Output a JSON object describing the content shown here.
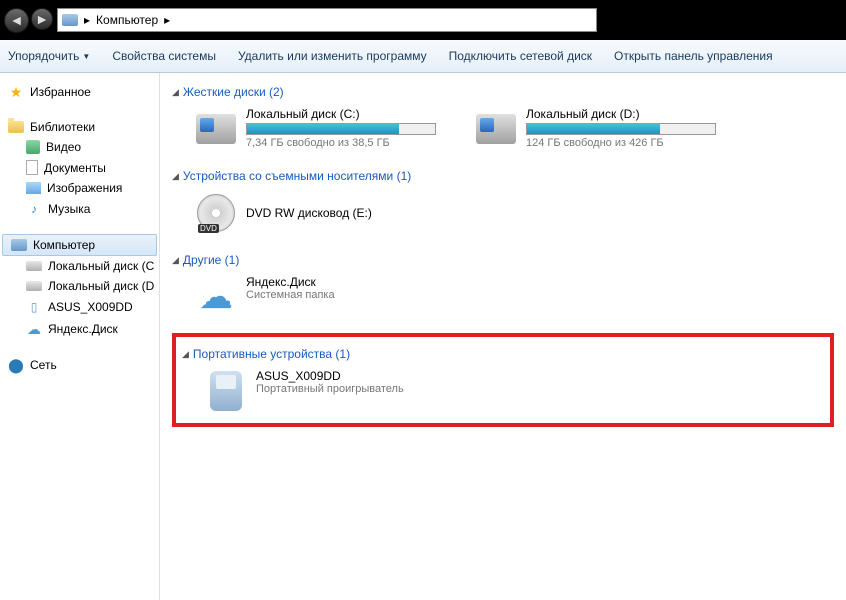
{
  "titlebar": {
    "location": "Компьютер"
  },
  "toolbar": {
    "organize": "Упорядочить",
    "props": "Свойства системы",
    "uninstall": "Удалить или изменить программу",
    "netdrive": "Подключить сетевой диск",
    "cpanel": "Открыть панель управления"
  },
  "sidebar": {
    "favorites": "Избранное",
    "libraries": "Библиотеки",
    "video": "Видео",
    "documents": "Документы",
    "pictures": "Изображения",
    "music": "Музыка",
    "computer": "Компьютер",
    "diskC": "Локальный диск (C",
    "diskD": "Локальный диск (D",
    "asus": "ASUS_X009DD",
    "yandex": "Яндекс.Диск",
    "network": "Сеть"
  },
  "sections": {
    "hdd": {
      "label": "Жесткие диски (2)"
    },
    "removable": {
      "label": "Устройства со съемными носителями (1)"
    },
    "other": {
      "label": "Другие (1)"
    },
    "portable": {
      "label": "Портативные устройства (1)"
    }
  },
  "drives": {
    "c": {
      "name": "Локальный диск (C:)",
      "info": "7,34 ГБ свободно из 38,5 ГБ",
      "fill": 81
    },
    "d": {
      "name": "Локальный диск (D:)",
      "info": "124 ГБ свободно из 426 ГБ",
      "fill": 71
    },
    "dvd": {
      "name": "DVD RW дисковод (E:)"
    },
    "yandex": {
      "name": "Яндекс.Диск",
      "sub": "Системная папка"
    },
    "asus": {
      "name": "ASUS_X009DD",
      "sub": "Портативный проигрыватель"
    }
  }
}
